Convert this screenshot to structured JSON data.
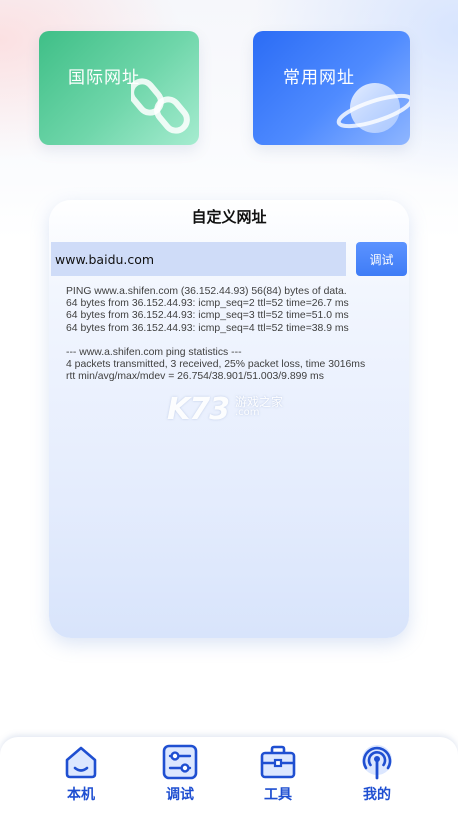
{
  "cards": {
    "international": {
      "title": "国际网址",
      "icon": "link-icon"
    },
    "common": {
      "title": "常用网址",
      "icon": "planet-icon"
    }
  },
  "panel": {
    "title": "自定义网址",
    "url_value": "www.baidu.com",
    "debug_button": "调试",
    "output_lines": [
      "PING www.a.shifen.com (36.152.44.93) 56(84) bytes of data.",
      "64 bytes from 36.152.44.93: icmp_seq=2 ttl=52 time=26.7 ms",
      "64 bytes from 36.152.44.93: icmp_seq=3 ttl=52 time=51.0 ms",
      "64 bytes from 36.152.44.93: icmp_seq=4 ttl=52 time=38.9 ms"
    ],
    "stats_lines": [
      "--- www.a.shifen.com ping statistics ---",
      "4 packets transmitted, 3 received, 25% packet loss, time 3016ms",
      "rtt min/avg/max/mdev = 26.754/38.901/51.003/9.899 ms"
    ]
  },
  "watermark": {
    "brand": "K73",
    "cn": "游戏之家",
    "domain": ".com"
  },
  "nav": {
    "items": [
      {
        "label": "本机",
        "icon": "home-icon"
      },
      {
        "label": "调试",
        "icon": "sliders-icon"
      },
      {
        "label": "工具",
        "icon": "toolbox-icon"
      },
      {
        "label": "我的",
        "icon": "signal-tower-icon"
      }
    ]
  },
  "colors": {
    "accent": "#1f4fd1",
    "button": "#4a86fb",
    "input_bg": "#cfdcf8",
    "card_green": "#3fbf87",
    "card_blue": "#2b6cf5"
  }
}
